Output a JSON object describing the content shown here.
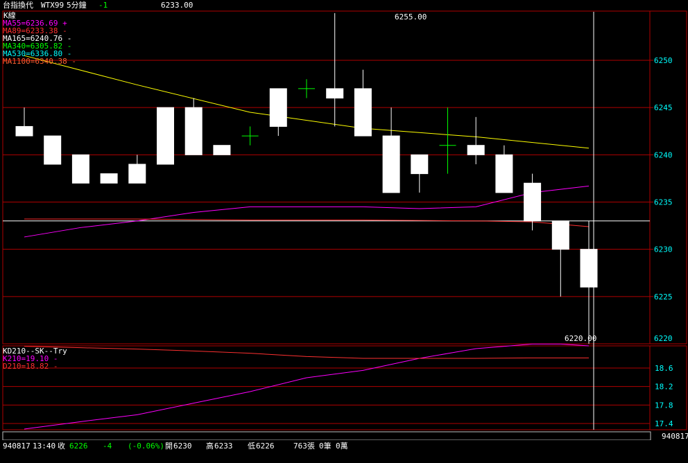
{
  "header": {
    "name": "台指換代",
    "symbol": "WTX99",
    "interval": "5分鐘",
    "change": "-1",
    "price": "6233.00"
  },
  "colors": {
    "grid": "#b00000",
    "up": "#ffffff",
    "down": "#ffffff",
    "ma55": "#ff00ff",
    "ma89": "#ff3030",
    "ma165": "#ffff00",
    "ma340": "#00ff00",
    "ma530": "#00ffff",
    "ma1100": "#ff6030",
    "k": "#ff00ff",
    "d": "#ff3030",
    "axis_text": "#00ffff"
  },
  "main_panel": {
    "title": "K線",
    "legend": [
      {
        "text": "MA55=6236.69",
        "mark": "+",
        "color": "#ff00ff"
      },
      {
        "text": "MA89=6233.38",
        "mark": "-",
        "color": "#ff3030"
      },
      {
        "text": "MA165=6240.76",
        "mark": "-",
        "color": "#ffffff"
      },
      {
        "text": "MA340=6305.82",
        "mark": "-",
        "color": "#00ff00"
      },
      {
        "text": "MA530=6336.80",
        "mark": "-",
        "color": "#00ffff"
      },
      {
        "text": "MA1100=6340.38",
        "mark": "-",
        "color": "#ff6030"
      }
    ],
    "high_label": "6255.00",
    "low_label": "6220.00",
    "cursor_price": "6233"
  },
  "sub_panel": {
    "title": "KD210--SK--Try",
    "legend": [
      {
        "text": "K210=19.10",
        "mark": "-",
        "color": "#ff00ff"
      },
      {
        "text": "D210=18.82",
        "mark": "-",
        "color": "#ff3030"
      }
    ]
  },
  "status": {
    "date": "940817",
    "time": "13:40",
    "close_label": "收",
    "close": "6226",
    "change": "-4",
    "change_pct": "(-0.06%)",
    "open_label": "開",
    "open": "6230",
    "high_label": "高",
    "high": "6233",
    "low_label": "低",
    "low": "6226",
    "volume": "763張",
    "trades": "0筆",
    "amount": "0萬",
    "cursor_date": "940817"
  },
  "chart_data": [
    {
      "type": "candlestick",
      "title": "K線",
      "y_ticks": [
        6220,
        6225,
        6230,
        6235,
        6240,
        6245,
        6250
      ],
      "ylim": [
        6219.5,
        6256.5
      ],
      "grid": true,
      "candles": [
        {
          "o": 6242,
          "h": 6245,
          "l": 6242,
          "c": 6243
        },
        {
          "o": 6242,
          "h": 6242,
          "l": 6239,
          "c": 6239
        },
        {
          "o": 6240,
          "h": 6240,
          "l": 6237,
          "c": 6237
        },
        {
          "o": 6238,
          "h": 6238,
          "l": 6237,
          "c": 6237
        },
        {
          "o": 6237,
          "h": 6240,
          "l": 6237,
          "c": 6239
        },
        {
          "o": 6239,
          "h": 6245,
          "l": 6239,
          "c": 6245
        },
        {
          "o": 6240,
          "h": 6246,
          "l": 6240,
          "c": 6245
        },
        {
          "o": 6241,
          "h": 6241,
          "l": 6240,
          "c": 6240
        },
        {
          "o": 6242,
          "h": 6243,
          "l": 6241,
          "c": 6242
        },
        {
          "o": 6243,
          "h": 6247,
          "l": 6242,
          "c": 6247
        },
        {
          "o": 6247,
          "h": 6248,
          "l": 6246,
          "c": 6247
        },
        {
          "o": 6246,
          "h": 6255,
          "l": 6243,
          "c": 6247
        },
        {
          "o": 6247,
          "h": 6249,
          "l": 6242,
          "c": 6242
        },
        {
          "o": 6242,
          "h": 6245,
          "l": 6236,
          "c": 6236
        },
        {
          "o": 6240,
          "h": 6240,
          "l": 6236,
          "c": 6238
        },
        {
          "o": 6241,
          "h": 6245,
          "l": 6238,
          "c": 6241
        },
        {
          "o": 6241,
          "h": 6244,
          "l": 6239,
          "c": 6240
        },
        {
          "o": 6240,
          "h": 6241,
          "l": 6236,
          "c": 6236
        },
        {
          "o": 6237,
          "h": 6238,
          "l": 6232,
          "c": 6233
        },
        {
          "o": 6233,
          "h": 6233,
          "l": 6225,
          "c": 6230
        },
        {
          "o": 6230,
          "h": 6233,
          "l": 6220,
          "c": 6226
        }
      ],
      "series": [
        {
          "name": "MA165",
          "color": "#ffff00",
          "x": [
            0,
            4,
            8,
            12,
            16,
            20
          ],
          "values": [
            6250.5,
            6247.4,
            6244.5,
            6242.8,
            6241.9,
            6240.7
          ]
        },
        {
          "name": "MA55",
          "color": "#ff00ff",
          "x": [
            0,
            2,
            4,
            6,
            8,
            10,
            12,
            14,
            16,
            18,
            20
          ],
          "values": [
            6231.3,
            6232.3,
            6233.0,
            6233.9,
            6234.5,
            6234.5,
            6234.5,
            6234.3,
            6234.5,
            6236.0,
            6236.7
          ]
        },
        {
          "name": "MA89",
          "color": "#ff3030",
          "x": [
            0,
            4,
            8,
            12,
            16,
            18,
            20
          ],
          "values": [
            6233.2,
            6233.2,
            6233.1,
            6233.1,
            6233.0,
            6232.9,
            6232.4
          ]
        }
      ]
    },
    {
      "type": "line",
      "title": "KD210--SK--Try",
      "y_ticks": [
        17.4,
        17.8,
        18.2,
        18.6
      ],
      "ylim": [
        17.25,
        19.2
      ],
      "grid": true,
      "x": [
        0,
        2,
        4,
        6,
        8,
        10,
        12,
        14,
        16,
        18,
        19,
        20
      ],
      "series": [
        {
          "name": "K210",
          "color": "#ff00ff",
          "values": [
            17.28,
            17.44,
            17.59,
            17.84,
            18.09,
            18.39,
            18.55,
            18.81,
            19.02,
            19.12,
            19.12,
            19.08
          ]
        },
        {
          "name": "D210",
          "color": "#ff3030",
          "values": [
            19.07,
            19.04,
            19.01,
            18.97,
            18.92,
            18.85,
            18.81,
            18.81,
            18.81,
            18.82,
            18.82,
            18.82
          ]
        }
      ]
    }
  ]
}
